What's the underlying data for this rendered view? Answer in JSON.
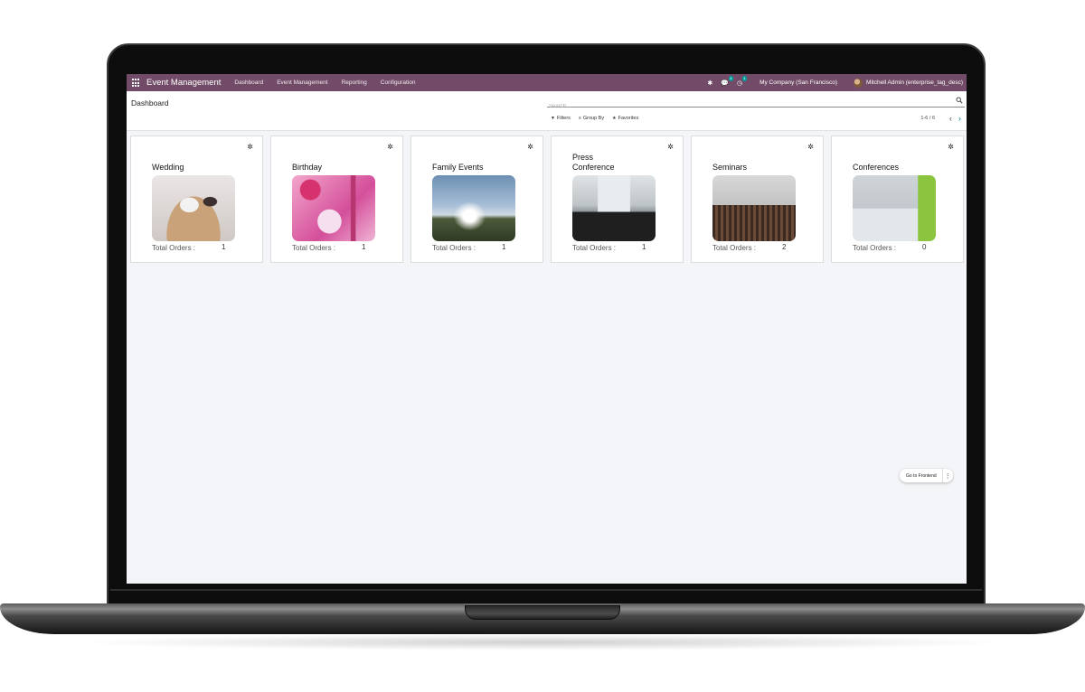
{
  "navbar": {
    "app_name": "Event Management",
    "menu": [
      "Dashboard",
      "Event Management",
      "Reporting",
      "Configuration"
    ],
    "messages_badge": "4",
    "activities_badge": "1",
    "company": "My Company (San Francisco)",
    "user": "Mitchell Admin (enterprise_tag_desc)"
  },
  "control_panel": {
    "breadcrumb": "Dashboard",
    "search_placeholder": "Search...",
    "filters": "Filters",
    "group_by": "Group By",
    "favorites": "Favorites",
    "pager": "1-6 / 6"
  },
  "cards": [
    {
      "title": "Wedding",
      "label": "Total Orders :",
      "value": "1"
    },
    {
      "title": "Birthday",
      "label": "Total Orders :",
      "value": "1"
    },
    {
      "title": "Family Events",
      "label": "Total Orders :",
      "value": "1"
    },
    {
      "title": "Press Conference",
      "label": "Total Orders :",
      "value": "1"
    },
    {
      "title": "Seminars",
      "label": "Total Orders :",
      "value": "2"
    },
    {
      "title": "Conferences",
      "label": "Total Orders :",
      "value": "0"
    }
  ],
  "frontend_button": "Go to Frontend",
  "colors": {
    "navbar": "#714b67",
    "accent": "#017e84"
  }
}
